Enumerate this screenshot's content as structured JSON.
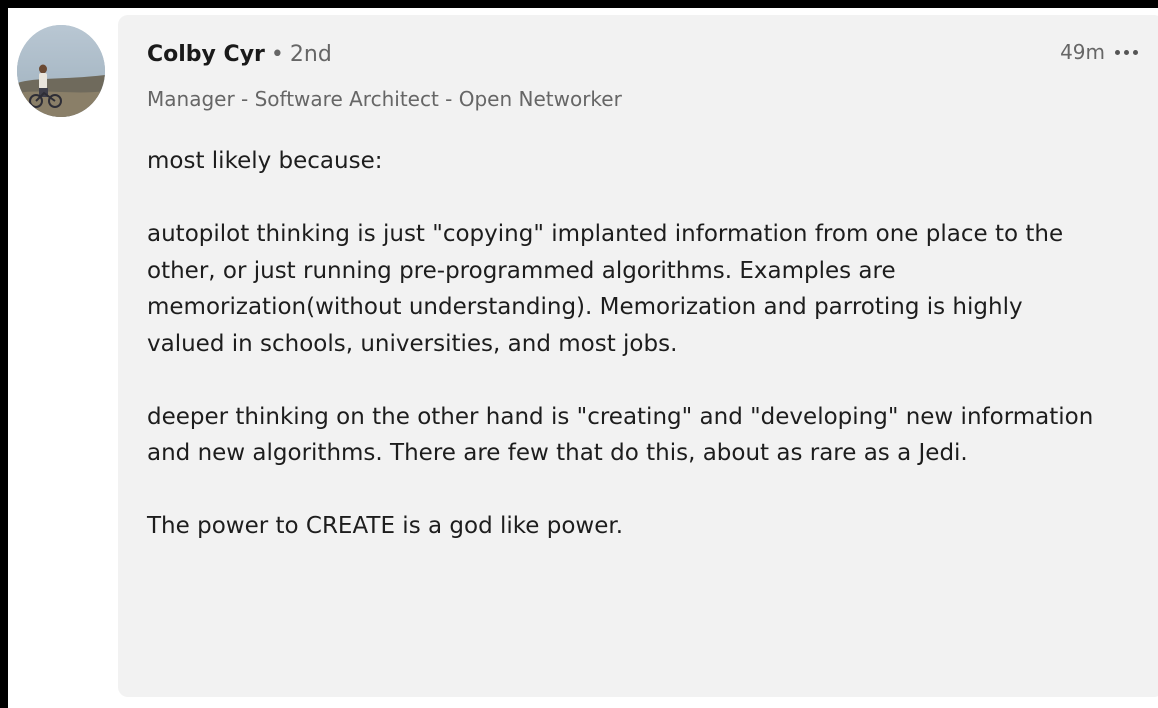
{
  "comment": {
    "author": {
      "name": "Colby Cyr",
      "separator": "•",
      "degree": "2nd",
      "headline": "Manager - Software Architect - Open Networker"
    },
    "timestamp": "49m",
    "more_icon": "ellipsis-horizontal-icon",
    "avatar_icon": "profile-photo",
    "paragraphs": [
      "most likely because:",
      "autopilot thinking is just \"copying\" implanted information from one place to the other, or just running pre-programmed algorithms. Examples are memorization(without understanding). Memorization and parroting is highly valued in schools, universities, and most jobs.",
      "deeper thinking on the other hand is \"creating\" and \"developing\" new information and new algorithms. There are few that do this, about as rare as a Jedi.",
      "The power to CREATE is a god like power."
    ]
  }
}
